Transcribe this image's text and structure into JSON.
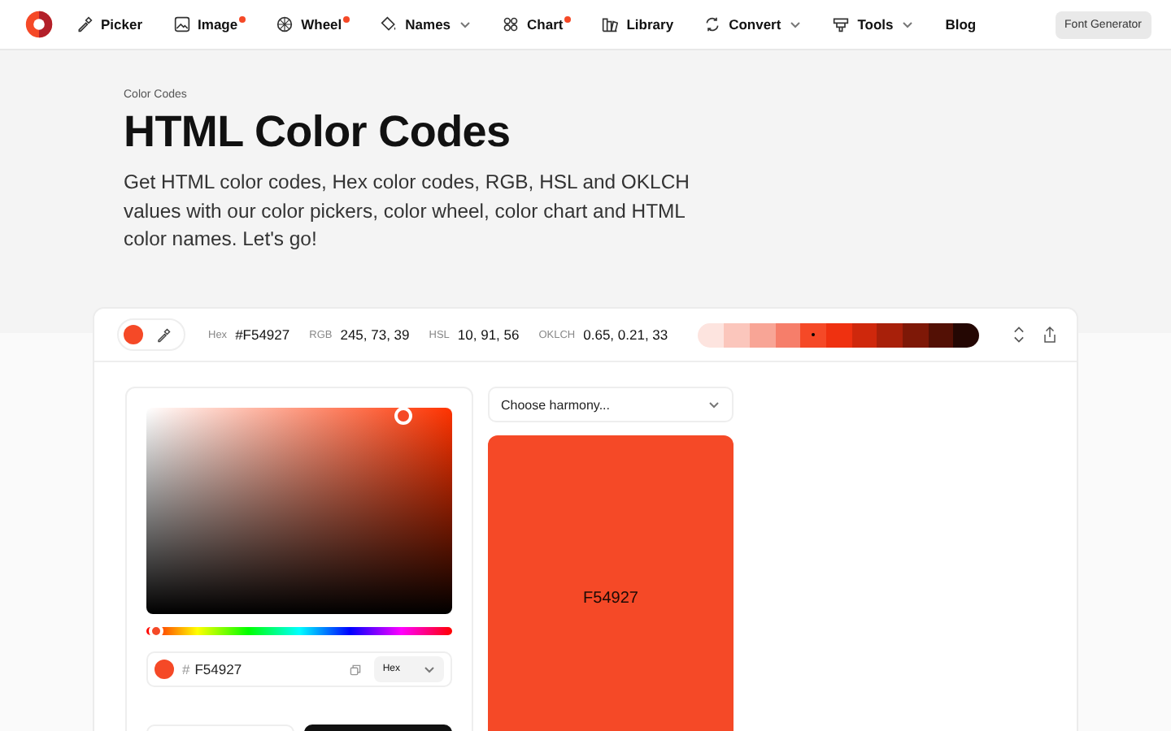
{
  "nav": {
    "items": [
      {
        "label": "Picker",
        "kind": "dropper",
        "dot": false,
        "dropdown": false
      },
      {
        "label": "Image",
        "kind": "image",
        "dot": true,
        "dropdown": false
      },
      {
        "label": "Wheel",
        "kind": "wheel",
        "dot": true,
        "dropdown": false
      },
      {
        "label": "Names",
        "kind": "bucket",
        "dot": false,
        "dropdown": true
      },
      {
        "label": "Chart",
        "kind": "grid",
        "dot": true,
        "dropdown": false
      },
      {
        "label": "Library",
        "kind": "books",
        "dot": false,
        "dropdown": false
      },
      {
        "label": "Convert",
        "kind": "convert",
        "dot": false,
        "dropdown": true
      },
      {
        "label": "Tools",
        "kind": "tools",
        "dot": false,
        "dropdown": true
      },
      {
        "label": "Blog",
        "kind": "text",
        "dot": false,
        "dropdown": false
      }
    ],
    "button": "Font Generator"
  },
  "hero": {
    "breadcrumb": "Color Codes",
    "title": "HTML Color Codes",
    "text": "Get HTML color codes, Hex color codes, RGB, HSL and OKLCH values with our color pickers, color wheel, color chart and HTML color names. Let's go!"
  },
  "toolbar": {
    "color": "#f54927",
    "values": [
      {
        "label": "Hex",
        "value": "#F54927"
      },
      {
        "label": "RGB",
        "value": "245, 73, 39"
      },
      {
        "label": "HSL",
        "value": "10, 91, 56"
      },
      {
        "label": "OKLCH",
        "value": "0.65, 0.21, 33"
      }
    ],
    "shades": [
      {
        "color": "#fde4df",
        "selected": false
      },
      {
        "color": "#fbc6bc",
        "selected": false
      },
      {
        "color": "#f8a596",
        "selected": false
      },
      {
        "color": "#f67e6a",
        "selected": false
      },
      {
        "color": "#f54927",
        "selected": true
      },
      {
        "color": "#ef3110",
        "selected": false
      },
      {
        "color": "#cf280c",
        "selected": false
      },
      {
        "color": "#a8200a",
        "selected": false
      },
      {
        "color": "#7e1807",
        "selected": false
      },
      {
        "color": "#531005",
        "selected": false
      },
      {
        "color": "#240703",
        "selected": false
      }
    ]
  },
  "picker": {
    "hue": {
      "level": 0.03
    },
    "hex_prefix": "#",
    "hex": "F54927",
    "format": "Hex"
  },
  "harmony": {
    "placeholder": "Choose harmony...",
    "swatch": "F54927"
  }
}
